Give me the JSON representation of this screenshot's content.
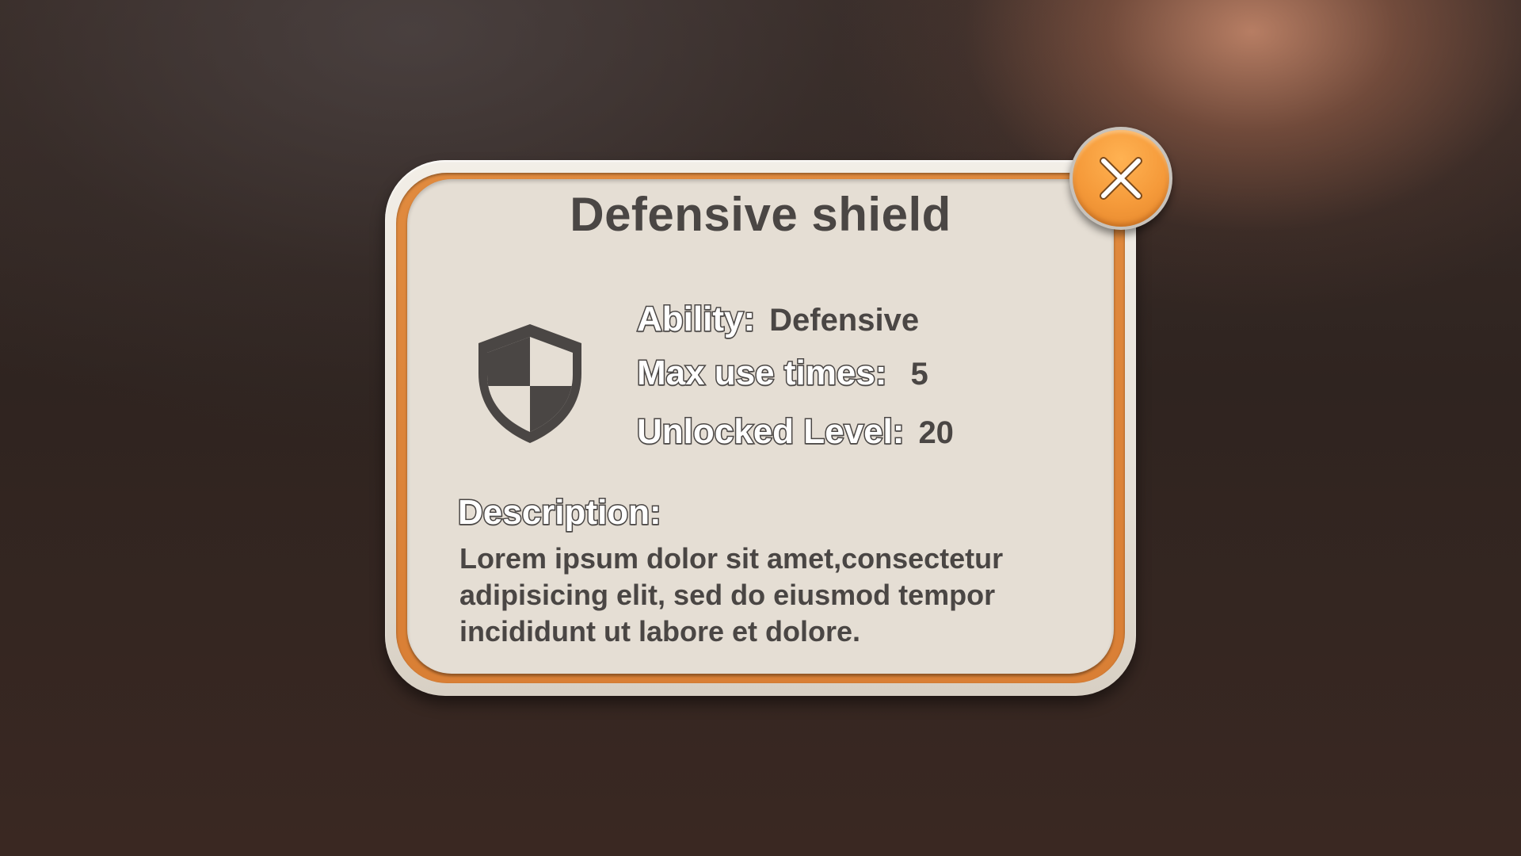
{
  "dialog": {
    "title": "Defensive shield",
    "icon": "shield-icon",
    "stats": {
      "ability_label": "Ability:",
      "ability_value": "Defensive",
      "max_use_label": "Max use times:",
      "max_use_value": "5",
      "level_label": "Unlocked Level:",
      "level_value": "20"
    },
    "description_heading": "Description:",
    "description_text": "Lorem ipsum dolor sit amet,consectetur adipisicing elit, sed do eiusmod tempor incididunt ut labore et dolore.",
    "close_icon": "close-icon"
  },
  "colors": {
    "accent_orange": "#f59a3a",
    "panel_border": "#d97f35",
    "panel_fill": "#e5ded4",
    "text_dark": "#4a4644"
  }
}
